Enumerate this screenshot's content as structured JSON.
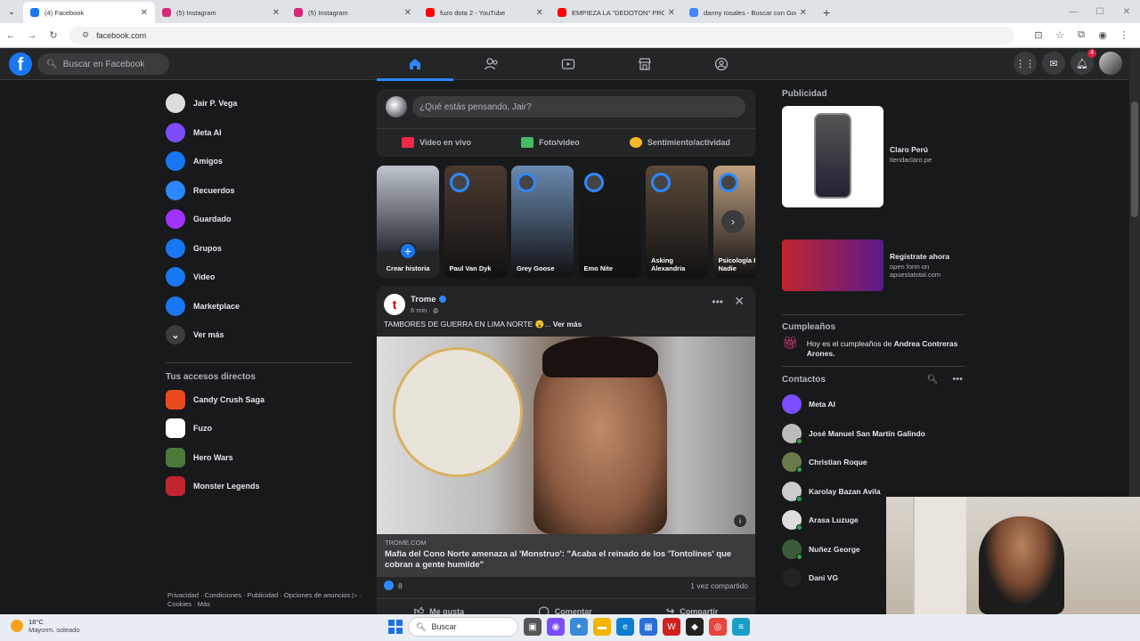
{
  "browser": {
    "tabs": [
      {
        "label": "(4) Facebook",
        "color": "#1877f2",
        "active": true
      },
      {
        "label": "(5) Instagram",
        "color": "#d62976",
        "active": false
      },
      {
        "label": "(5) Instagram",
        "color": "#d62976",
        "active": false
      },
      {
        "label": "fuzo dota 2 - YouTube",
        "color": "#ff0000",
        "active": false
      },
      {
        "label": "EMPIEZA LA \"DEDOTON\" PRO P",
        "color": "#ff0000",
        "active": false
      },
      {
        "label": "danny rosales - Buscar con Goo",
        "color": "#4285f4",
        "active": false
      }
    ],
    "url": "facebook.com"
  },
  "fb": {
    "logo": "f",
    "search_placeholder": "Buscar en Facebook",
    "nav_icons": [
      "home-icon",
      "friends-icon",
      "video-icon",
      "marketplace-icon",
      "groups-icon"
    ],
    "notifications_count": "4"
  },
  "left": {
    "items": [
      {
        "label": "Jair P. Vega",
        "icon": "avatar",
        "color": "#ddd"
      },
      {
        "label": "Meta AI",
        "icon": "meta-ai-icon",
        "color": "#7b4dff"
      },
      {
        "label": "Amigos",
        "icon": "friends-icon",
        "color": "#1877f2"
      },
      {
        "label": "Recuerdos",
        "icon": "clock-icon",
        "color": "#2d88ff"
      },
      {
        "label": "Guardado",
        "icon": "bookmark-icon",
        "color": "#a033ff"
      },
      {
        "label": "Grupos",
        "icon": "groups-icon",
        "color": "#1877f2"
      },
      {
        "label": "Video",
        "icon": "video-icon",
        "color": "#1877f2"
      },
      {
        "label": "Marketplace",
        "icon": "marketplace-icon",
        "color": "#1877f2"
      },
      {
        "label": "Ver más",
        "icon": "chevron-down-icon",
        "color": "#3a3b3c"
      }
    ],
    "shortcuts_title": "Tus accesos directos",
    "shortcuts": [
      {
        "label": "Candy Crush Saga",
        "color": "#e94a1d"
      },
      {
        "label": "Fuzo",
        "color": "#ffffff"
      },
      {
        "label": "Hero Wars",
        "color": "#4a7a3a"
      },
      {
        "label": "Monster Legends",
        "color": "#c0262d"
      }
    ],
    "footer": "Privacidad · Condiciones · Publicidad · Opciones de anuncios ▷ · Cookies · Más"
  },
  "composer": {
    "placeholder": "¿Qué estás pensando, Jair?",
    "actions": [
      {
        "label": "Video en vivo",
        "color": "#f02849"
      },
      {
        "label": "Foto/video",
        "color": "#45bd62"
      },
      {
        "label": "Sentimiento/actividad",
        "color": "#f7b928"
      }
    ]
  },
  "stories": [
    {
      "name": "Crear historia"
    },
    {
      "name": "Paul Van Dyk",
      "color": "#4a3a30"
    },
    {
      "name": "Grey Goose",
      "color": "#6a8ab0"
    },
    {
      "name": "Emo Nite",
      "color": "#1a1a1a"
    },
    {
      "name": "Asking Alexandria",
      "color": "#5a4a3a"
    },
    {
      "name": "Psicología P Nadie",
      "color": "#c0a080"
    }
  ],
  "post": {
    "page_name": "Trome",
    "page_logo": "t",
    "time": "6 min · ",
    "text": "TAMBORES DE GUERRA EN LIMA NORTE 😮... ",
    "see_more": "Ver más",
    "link_domain": "TROME.COM",
    "link_title": "Mafia del Cono Norte amenaza al 'Monstruo': \"Acaba el reinado de los 'Tontolines' que cobran a gente humilde\"",
    "likes": "8",
    "shares": "1 vez compartido",
    "actions": [
      "Me gusta",
      "Comentar",
      "Compartir"
    ]
  },
  "right": {
    "ads_title": "Publicidad",
    "ads": [
      {
        "name": "Claro Perú",
        "site": "tiendaclaro.pe"
      },
      {
        "name": "Regístrate ahora",
        "site": "open form on apuestatotal.com"
      }
    ],
    "birthdays_title": "Cumpleaños",
    "birthday_prefix": "Hoy es el cumpleaños de ",
    "birthday_name": "Andrea Contreras Arones.",
    "contacts_title": "Contactos",
    "contacts": [
      {
        "name": "Meta AI",
        "color": "#7b4dff",
        "online": false
      },
      {
        "name": "José Manuel San Martín Galindo",
        "color": "#bbb",
        "online": true
      },
      {
        "name": "Christian Roque",
        "color": "#6a7a4a",
        "online": true
      },
      {
        "name": "Karolay Bazan Avila",
        "color": "#ccc",
        "online": true
      },
      {
        "name": "Arasa Luzuge",
        "color": "#ddd",
        "online": true
      },
      {
        "name": "Nuñez George",
        "color": "#3a5a3a",
        "online": true
      },
      {
        "name": "Dani VG",
        "color": "#222",
        "online": false
      }
    ]
  },
  "taskbar": {
    "temp": "18°C",
    "weather": "Mayorm. soleado",
    "search": "Buscar"
  }
}
